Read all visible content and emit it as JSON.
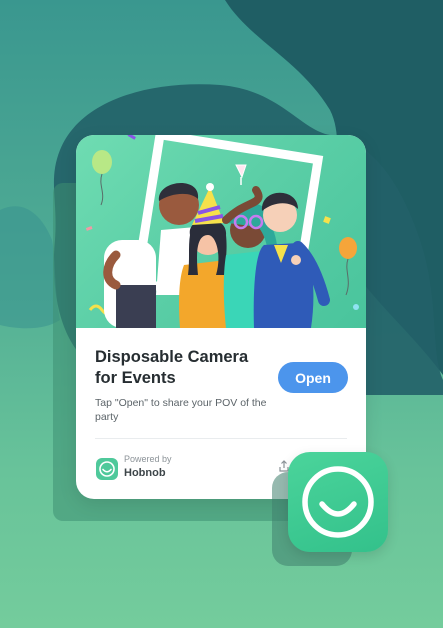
{
  "card": {
    "title_line1": "Disposable Camera",
    "title_line2": "for Events",
    "subtitle": "Tap \"Open\" to share your POV of the party",
    "open_label": "Open",
    "powered_by": "Powered by",
    "brand": "Hobnob"
  },
  "icons": {
    "hero": "party-photo-illustration",
    "brand_logo": "hobnob-smile-icon",
    "app_icon": "hobnob-app-icon",
    "share": "share-icon"
  },
  "colors": {
    "accent_button": "#4c95ec",
    "brand_green": "#3fcf93",
    "bg_dark": "#1e5a62"
  }
}
